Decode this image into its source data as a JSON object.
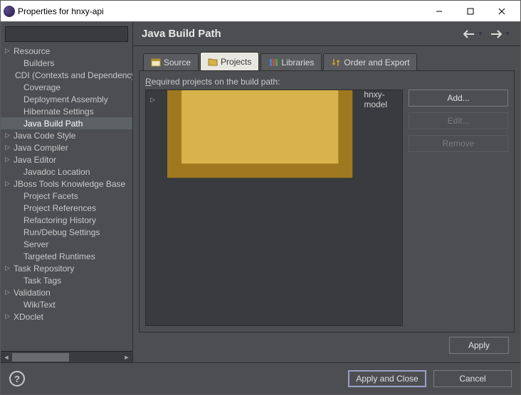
{
  "window": {
    "title": "Properties for hnxy-api",
    "controls": {
      "minimize": "–",
      "maximize": "☐",
      "close": "✕"
    }
  },
  "sidebar": {
    "items": [
      {
        "label": "Resource",
        "expandable": true
      },
      {
        "label": "Builders",
        "expandable": false,
        "child": true
      },
      {
        "label": "CDI (Contexts and Dependency Injection)",
        "expandable": false,
        "child": true
      },
      {
        "label": "Coverage",
        "expandable": false,
        "child": true
      },
      {
        "label": "Deployment Assembly",
        "expandable": false,
        "child": true
      },
      {
        "label": "Hibernate Settings",
        "expandable": false,
        "child": true
      },
      {
        "label": "Java Build Path",
        "expandable": false,
        "child": true,
        "selected": true
      },
      {
        "label": "Java Code Style",
        "expandable": true
      },
      {
        "label": "Java Compiler",
        "expandable": true
      },
      {
        "label": "Java Editor",
        "expandable": true
      },
      {
        "label": "Javadoc Location",
        "expandable": false,
        "child": true
      },
      {
        "label": "JBoss Tools Knowledge Base",
        "expandable": true
      },
      {
        "label": "Project Facets",
        "expandable": false,
        "child": true
      },
      {
        "label": "Project References",
        "expandable": false,
        "child": true
      },
      {
        "label": "Refactoring History",
        "expandable": false,
        "child": true
      },
      {
        "label": "Run/Debug Settings",
        "expandable": false,
        "child": true
      },
      {
        "label": "Server",
        "expandable": false,
        "child": true
      },
      {
        "label": "Targeted Runtimes",
        "expandable": false,
        "child": true
      },
      {
        "label": "Task Repository",
        "expandable": true
      },
      {
        "label": "Task Tags",
        "expandable": false,
        "child": true
      },
      {
        "label": "Validation",
        "expandable": true
      },
      {
        "label": "WikiText",
        "expandable": false,
        "child": true
      },
      {
        "label": "XDoclet",
        "expandable": true
      }
    ]
  },
  "main": {
    "title": "Java Build Path",
    "tabs": [
      {
        "label": "Source",
        "icon": "source-icon"
      },
      {
        "label": "Projects",
        "icon": "projects-icon",
        "active": true
      },
      {
        "label": "Libraries",
        "icon": "libraries-icon"
      },
      {
        "label": "Order and Export",
        "icon": "order-icon"
      }
    ],
    "panel": {
      "label_prefix": "R",
      "label_rest": "equired projects on the build path:",
      "projects": [
        {
          "label": "hnxy-model"
        }
      ],
      "buttons": {
        "add": "Add...",
        "edit": "Edit...",
        "remove": "Remove"
      }
    },
    "apply": "Apply"
  },
  "footer": {
    "apply_close": "Apply and Close",
    "cancel": "Cancel"
  }
}
